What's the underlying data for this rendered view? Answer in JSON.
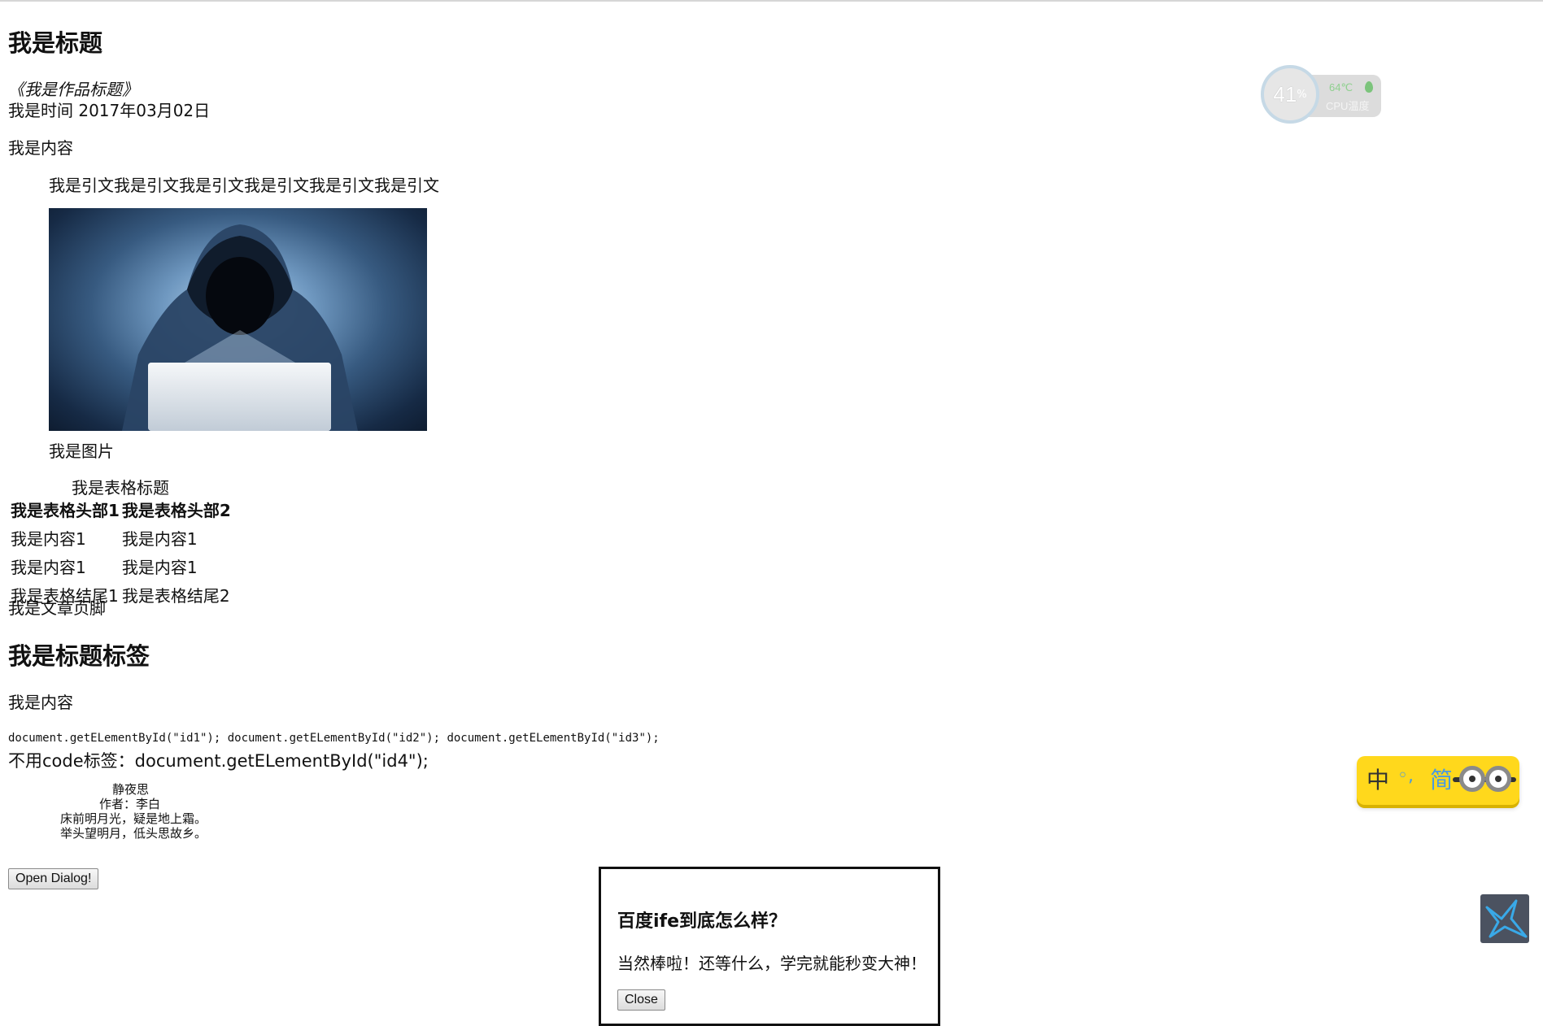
{
  "article": {
    "title": "我是标题",
    "work_title": "《我是作品标题》",
    "time_label": "我是时间",
    "time_value": "2017年03月02日",
    "content": "我是内容",
    "quote": "我是引文我是引文我是引文我是引文我是引文我是引文",
    "figure_caption": "我是图片",
    "table": {
      "caption": "我是表格标题",
      "headers": [
        "我是表格头部1",
        "我是表格头部2"
      ],
      "rows": [
        [
          "我是内容1",
          "我是内容1"
        ],
        [
          "我是内容1",
          "我是内容1"
        ]
      ],
      "footer": [
        "我是表格结尾1",
        "我是表格结尾2"
      ]
    },
    "footer": "我是文章页脚"
  },
  "section": {
    "heading": "我是标题标签",
    "content": "我是内容",
    "code_line": "document.getELementById(\"id1\"); document.getELementById(\"id2\"); document.getELementById(\"id3\");",
    "no_code_line": "不用code标签：document.getELementById(\"id4\");",
    "poem": {
      "title": "静夜思",
      "author": "作者：李白",
      "line1": "床前明月光，疑是地上霜。",
      "line2": "举头望明月，低头思故乡。"
    }
  },
  "open_button_label": "Open Dialog!",
  "dialog": {
    "title": "百度ife到底怎么样？",
    "text": "当然棒啦！还等什么，学完就能秒变大神！",
    "close_label": "Close"
  },
  "cpu_widget": {
    "usage_percent": "41",
    "percent_sign": "%",
    "temperature": "64℃",
    "label": "CPU温度"
  },
  "ime_widget": {
    "mode": "中",
    "punctuation": "◦,",
    "script": "简"
  },
  "icons": {
    "hero_image": "hooded-hacker-laptop-image",
    "side_button": "bird-icon"
  }
}
